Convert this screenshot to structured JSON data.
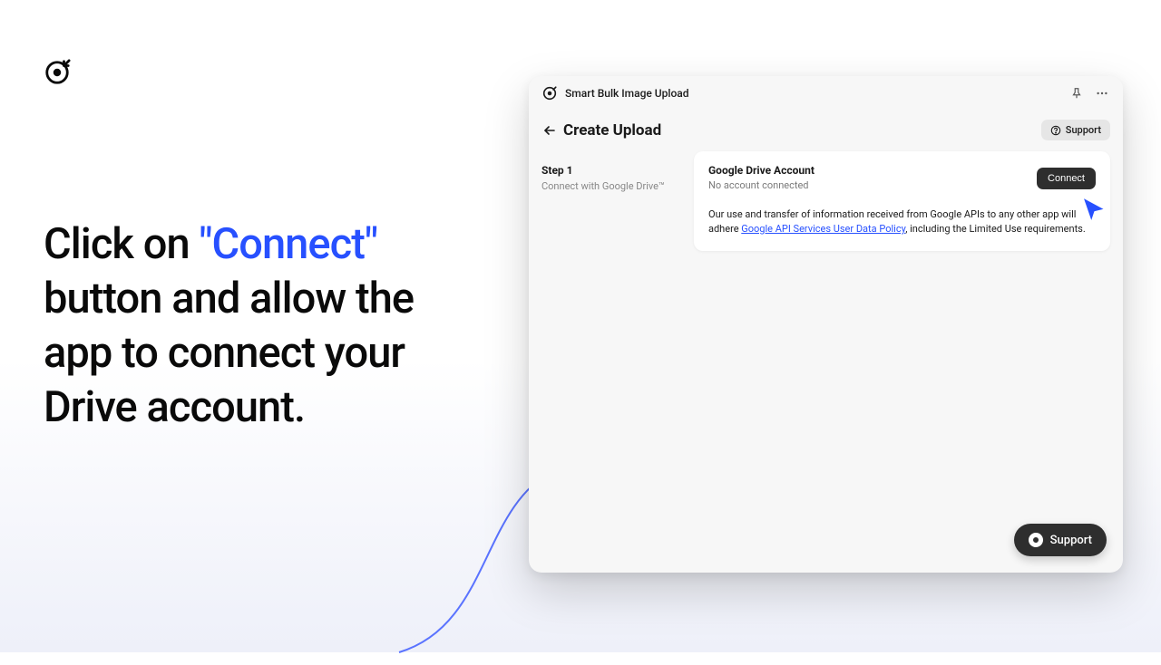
{
  "hero": {
    "prefix": "Click on ",
    "highlight": "\"Connect\"",
    "suffix": " button and allow the app to connect your Drive account."
  },
  "window": {
    "app_title": "Smart Bulk Image Upload"
  },
  "page": {
    "title": "Create Upload",
    "support_label": "Support"
  },
  "step": {
    "title": "Step 1",
    "subtitle": "Connect with Google Drive™"
  },
  "card": {
    "title": "Google Drive Account",
    "subtitle": "No account connected",
    "connect_label": "Connect",
    "policy_prefix": "Our use and transfer of information received from Google APIs to any other app will adhere ",
    "policy_link_text": "Google API Services User Data Policy",
    "policy_suffix": ", including the Limited Use requirements."
  },
  "fab": {
    "support_label": "Support"
  }
}
